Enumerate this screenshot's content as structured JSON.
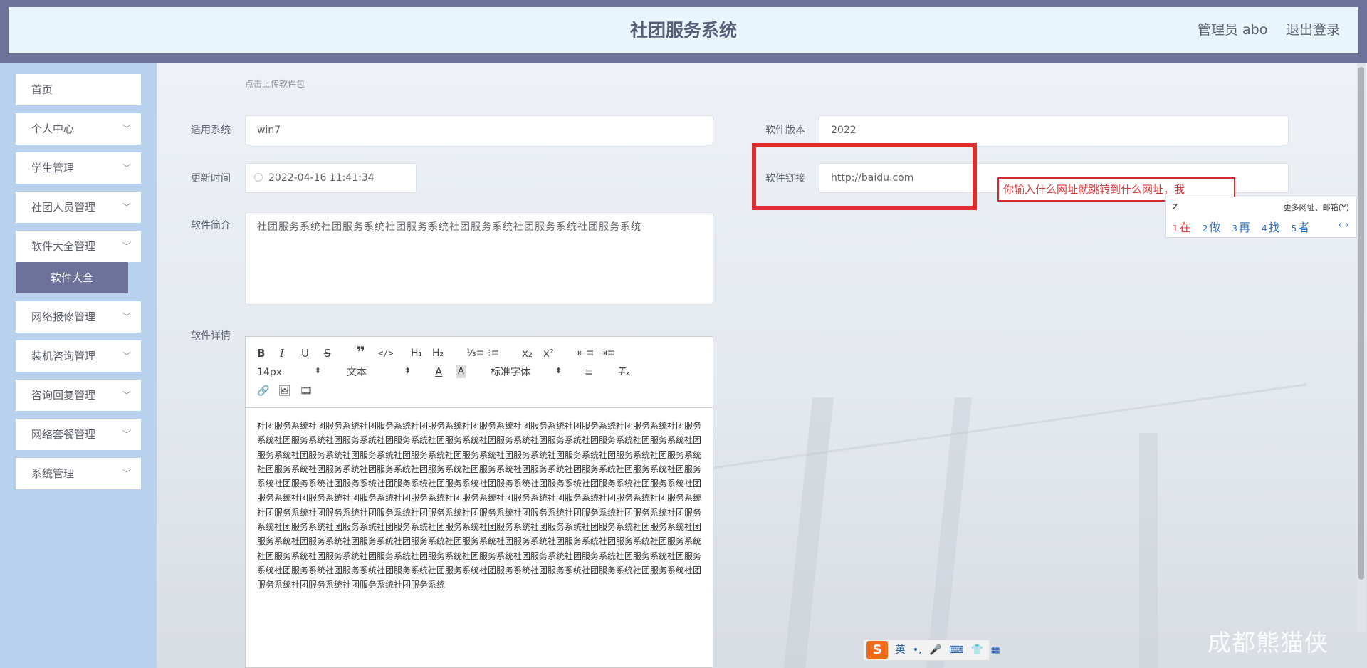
{
  "header": {
    "title": "社团服务系统",
    "user_label": "管理员 abo",
    "logout_label": "退出登录"
  },
  "sidebar": {
    "items": [
      {
        "label": "首页",
        "expandable": false
      },
      {
        "label": "个人中心",
        "expandable": true
      },
      {
        "label": "学生管理",
        "expandable": true
      },
      {
        "label": "社团人员管理",
        "expandable": true
      },
      {
        "label": "软件大全管理",
        "expandable": true
      },
      {
        "label": "网络报修管理",
        "expandable": true
      },
      {
        "label": "装机咨询管理",
        "expandable": true
      },
      {
        "label": "咨询回复管理",
        "expandable": true
      },
      {
        "label": "网络套餐管理",
        "expandable": true
      },
      {
        "label": "系统管理",
        "expandable": true
      }
    ],
    "active_subitem": "软件大全"
  },
  "form": {
    "upload_hint": "点击上传软件包",
    "os_label": "适用系统",
    "os_value": "win7",
    "version_label": "软件版本",
    "version_value": "2022",
    "update_time_label": "更新时间",
    "update_time_value": "2022-04-16 11:41:34",
    "link_label": "软件链接",
    "link_value": "http://baidu.com",
    "intro_label": "软件简介",
    "intro_value": "社团服务系统社团服务系统社团服务系统社团服务系统社团服务系统社团服务系统",
    "details_label": "软件详情"
  },
  "annotation": {
    "text": "你输入什么网址就跳转到什么网址，我"
  },
  "ime": {
    "input": "z",
    "more_label": "更多网址、邮箱(Y)",
    "candidates": [
      {
        "num": "1",
        "text": "在"
      },
      {
        "num": "2",
        "text": "做"
      },
      {
        "num": "3",
        "text": "再"
      },
      {
        "num": "4",
        "text": "找"
      },
      {
        "num": "5",
        "text": "者"
      }
    ],
    "arrows": "‹ ›"
  },
  "editor": {
    "font_size": "14px",
    "paragraph": "文本",
    "font_family": "标准字体",
    "content": "社团服务系统社团服务系统社团服务系统社团服务系统社团服务系统社团服务系统社团服务系统社团服务系统社团服务系统社团服务系统社团服务系统社团服务系统社团服务系统社团服务系统社团服务系统社团服务系统社团服务系统社团服务系统社团服务系统社团服务系统社团服务系统社团服务系统社团服务系统社团服务系统社团服务系统社团服务系统社团服务系统社团服务系统社团服务系统社团服务系统社团服务系统社团服务系统社团服务系统社团服务系统社团服务系统社团服务系统社团服务系统社团服务系统社团服务系统社团服务系统社团服务系统社团服务系统社团服务系统社团服务系统社团服务系统社团服务系统社团服务系统社团服务系统社团服务系统社团服务系统社团服务系统社团服务系统社团服务系统社团服务系统社团服务系统社团服务系统社团服务系统社团服务系统社团服务系统社团服务系统社团服务系统社团服务系统社团服务系统社团服务系统社团服务系统社团服务系统社团服务系统社团服务系统社团服务系统社团服务系统社团服务系统社团服务系统社团服务系统社团服务系统社团服务系统社团服务系统社团服务系统社团服务系统社团服务系统社团服务系统社团服务系统社团服务系统社团服务系统社团服务系统社团服务系统社团服务系统社团服务系统社团服务系统社团服务系统社团服务系统社团服务系统社团服务系统社团服务系统社团服务系统社团服务系统社团服务系统社团服务系统社团服务系统社团服务系统"
  },
  "sogou_bar": {
    "logo": "S",
    "lang": "英",
    "punct": "•,"
  },
  "watermark": "成都熊猫侠",
  "colors": {
    "header_frame": "#6e7199",
    "header_bg": "#e8f5fc",
    "sidebar_bg": "#b8d1ec",
    "active_submenu": "#6e7199",
    "highlight_red": "#e02c2c"
  }
}
